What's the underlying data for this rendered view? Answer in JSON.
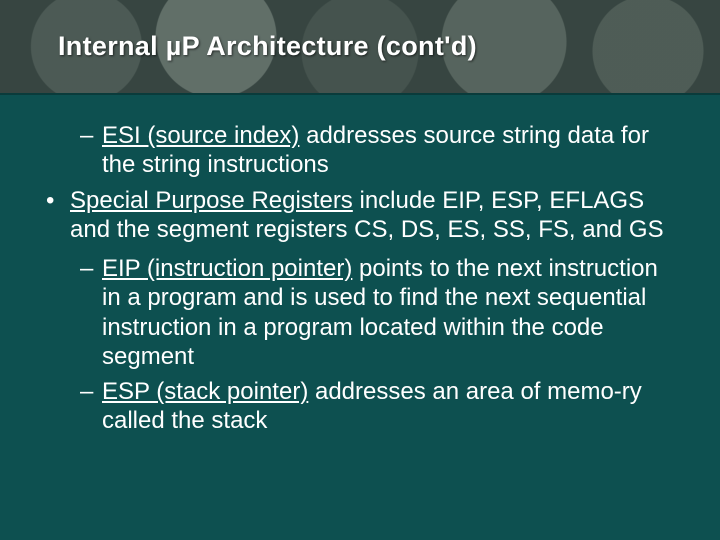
{
  "title": "Internal µP Architecture (cont'd)",
  "bullets": {
    "esi": {
      "term": "ESI (source index)",
      "rest": " addresses source string data for the string instructions"
    },
    "special": {
      "term": "Special Purpose Registers",
      "rest": " include EIP, ESP, EFLAGS and the segment registers CS, DS, ES, SS, FS, and GS"
    },
    "eip": {
      "term": "EIP (instruction pointer)",
      "rest": " points to the next instruction in a program and is used to find the next sequential instruction in a program located within the code segment"
    },
    "esp": {
      "term": "ESP (stack pointer)",
      "rest": " addresses an area of memo-ry called the stack"
    }
  },
  "markers": {
    "dash": "–",
    "bullet": "•"
  }
}
